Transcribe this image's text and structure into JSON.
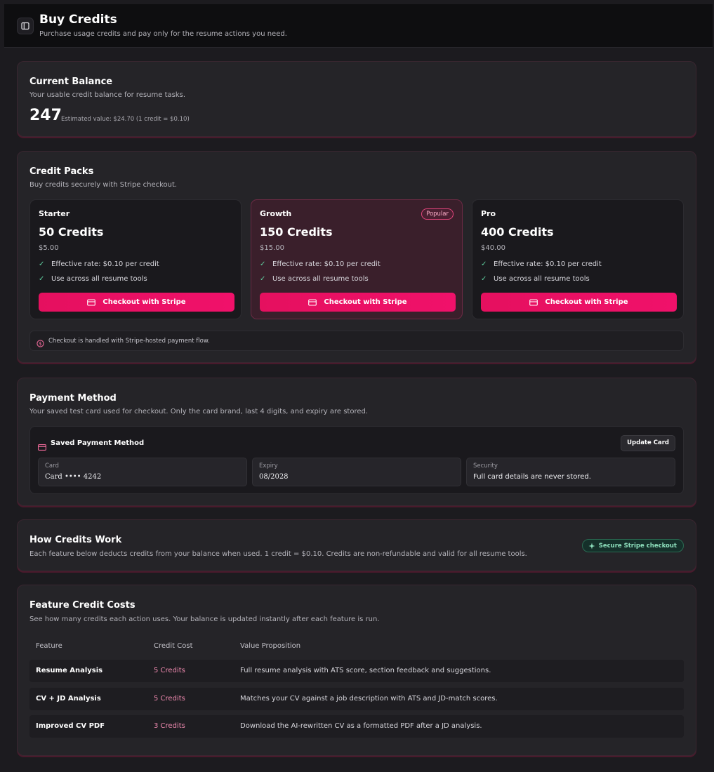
{
  "header": {
    "title": "Buy Credits",
    "subtitle": "Purchase usage credits and pay only for the resume actions you need."
  },
  "balance": {
    "title": "Current Balance",
    "subtitle": "Your usable credit balance for resume tasks.",
    "amount": "247",
    "estimate": "Estimated value: $24.70 (1 credit = $0.10)"
  },
  "packs": {
    "title": "Credit Packs",
    "subtitle": "Buy credits securely with Stripe checkout.",
    "items": [
      {
        "name": "Starter",
        "credits": "50 Credits",
        "price": "$5.00",
        "feature1": "Effective rate: $0.10 per credit",
        "feature2": "Use across all resume tools",
        "button": "Checkout with Stripe"
      },
      {
        "name": "Growth",
        "badge": "Popular",
        "credits": "150 Credits",
        "price": "$15.00",
        "feature1": "Effective rate: $0.10 per credit",
        "feature2": "Use across all resume tools",
        "button": "Checkout with Stripe"
      },
      {
        "name": "Pro",
        "credits": "400 Credits",
        "price": "$40.00",
        "feature1": "Effective rate: $0.10 per credit",
        "feature2": "Use across all resume tools",
        "button": "Checkout with Stripe"
      }
    ],
    "note": "Checkout is handled with Stripe-hosted payment flow."
  },
  "payment": {
    "title": "Payment Method",
    "subtitle": "Your saved test card used for checkout. Only the card brand, last 4 digits, and expiry are stored.",
    "box_title": "Saved Payment Method",
    "update_button": "Update Card",
    "fields": [
      {
        "label": "Card",
        "value": "Card •••• 4242"
      },
      {
        "label": "Expiry",
        "value": "08/2028"
      },
      {
        "label": "Security",
        "value": "Full card details are never stored."
      }
    ]
  },
  "how": {
    "title": "How Credits Work",
    "subtitle": "Each feature below deducts credits from your balance when used. 1 credit = $0.10. Credits are non-refundable and valid for all resume tools.",
    "pill": "Secure Stripe checkout"
  },
  "costs": {
    "title": "Feature Credit Costs",
    "subtitle": "See how many credits each action uses. Your balance is updated instantly after each feature is run.",
    "columns": [
      "Feature",
      "Credit Cost",
      "Value Proposition"
    ],
    "rows": [
      {
        "feature": "Resume Analysis",
        "cost": "5 Credits",
        "value": "Full resume analysis with ATS score, section feedback and suggestions."
      },
      {
        "feature": "CV + JD Analysis",
        "cost": "5 Credits",
        "value": "Matches your CV against a job description with ATS and JD-match scores."
      },
      {
        "feature": "Improved CV PDF",
        "cost": "3 Credits",
        "value": "Download the AI-rewritten CV as a formatted PDF after a JD analysis."
      }
    ]
  },
  "colors": {
    "accent": "#e5105f",
    "background": "#1c1b1f",
    "card": "#252428",
    "success": "#5fd0a0"
  }
}
